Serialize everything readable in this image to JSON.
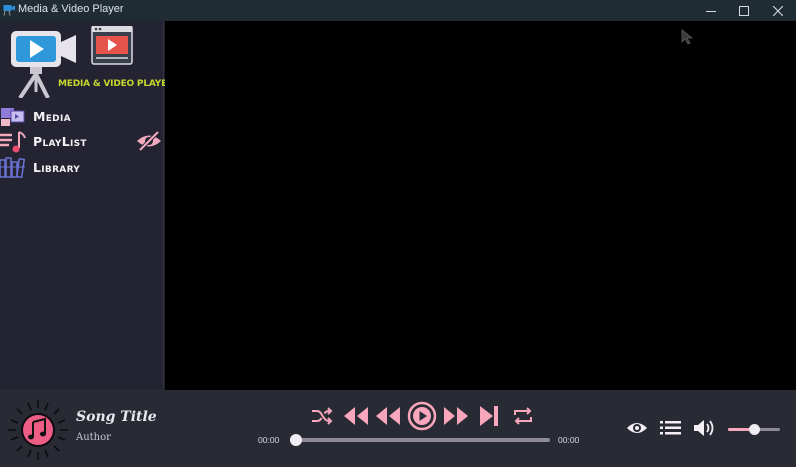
{
  "window": {
    "title": "Media & Video Player",
    "minimize": "minimize",
    "maximize": "maximize",
    "close": "close"
  },
  "sidebar": {
    "logo_text": "MEDIA & VIDEO PLAYER",
    "items": [
      {
        "label": "Media",
        "icon": "media-icon"
      },
      {
        "label": "PlayList",
        "icon": "playlist-icon"
      },
      {
        "label": "Library",
        "icon": "library-icon"
      }
    ],
    "toggle_icon": "eye-slash-icon"
  },
  "now_playing": {
    "title": "Song Title",
    "author": "Author",
    "art_icon": "music-note-icon"
  },
  "transport": {
    "shuffle_icon": "shuffle-icon",
    "rewind_icon": "rewind-icon",
    "previous_icon": "previous-icon",
    "play_icon": "play-icon",
    "forward_icon": "fast-forward-icon",
    "next_icon": "next-icon",
    "repeat_icon": "repeat-icon"
  },
  "progress": {
    "current_time": "00:00",
    "total_time": "00:00",
    "fraction": 0.0
  },
  "right_controls": {
    "eye_icon": "eye-icon",
    "list_icon": "list-icon",
    "volume_icon": "volume-icon",
    "volume_fraction": 0.5
  },
  "colors": {
    "accent": "#f7a6bc",
    "logo_text": "#c4d62e",
    "sidebar_bg": "#232331",
    "control_bg": "#282a34",
    "video_bg": "#000000"
  }
}
